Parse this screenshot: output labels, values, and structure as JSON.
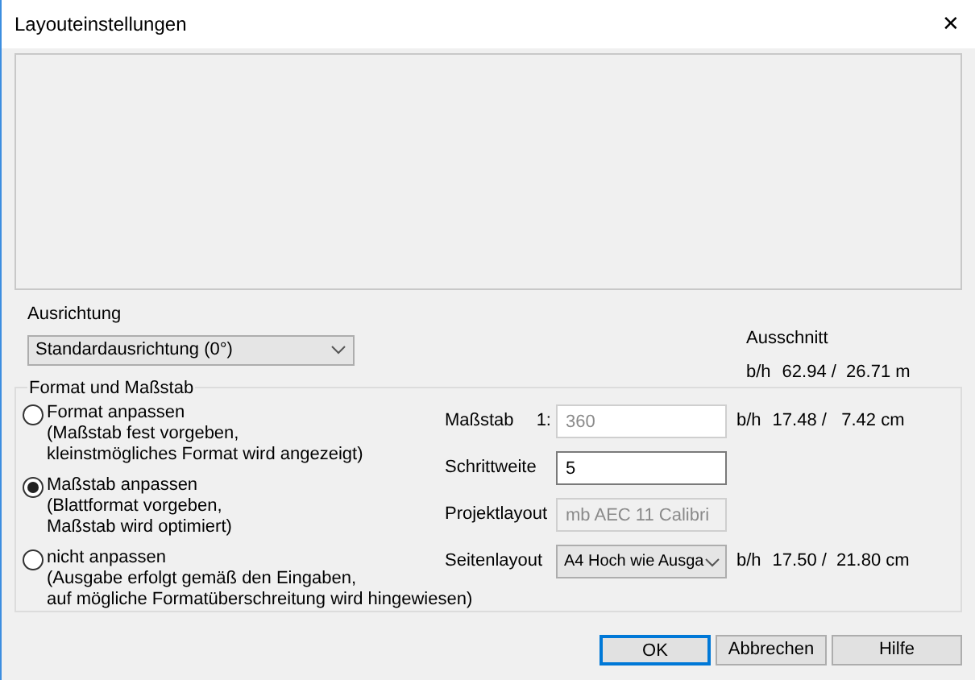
{
  "window": {
    "title": "Layouteinstellungen",
    "close": "✕"
  },
  "orientation": {
    "label": "Ausrichtung",
    "value": "Standardausrichtung (0°)"
  },
  "extent": {
    "title": "Ausschnitt",
    "label": "b/h",
    "value": "62.94 /  26.71 m"
  },
  "group": {
    "title": "Format und Maßstab",
    "options": [
      {
        "label": "Format anpassen",
        "lines": [
          "(Maßstab fest vorgeben,",
          "kleinstmögliches Format wird angezeigt)"
        ],
        "selected": false
      },
      {
        "label": "Maßstab anpassen",
        "lines": [
          "(Blattformat vorgeben,",
          "Maßstab wird optimiert)"
        ],
        "selected": true
      },
      {
        "label": "nicht anpassen",
        "lines": [
          "(Ausgabe erfolgt gemäß den Eingaben,",
          "auf mögliche Formatüberschreitung wird hingewiesen)"
        ],
        "selected": false
      }
    ],
    "fields": [
      {
        "kind": "input",
        "label": "Maßstab",
        "prefix": "1:",
        "value": "360",
        "disabled": true,
        "reading_label": "b/h",
        "reading": "17.48 /   7.42 cm"
      },
      {
        "kind": "input",
        "label": "Schrittweite",
        "value": "5",
        "disabled": false
      },
      {
        "kind": "input",
        "label": "Projektlayout",
        "value": "mb AEC 11 Calibri",
        "disabled": true
      },
      {
        "kind": "select",
        "label": "Seitenlayout",
        "value": "A4 Hoch wie Ausga",
        "reading_label": "b/h",
        "reading": "17.50 /  21.80 cm"
      }
    ]
  },
  "buttons": [
    {
      "label": "OK",
      "default": true
    },
    {
      "label": "Abbrechen",
      "default": false
    },
    {
      "label": "Hilfe",
      "default": false
    }
  ]
}
